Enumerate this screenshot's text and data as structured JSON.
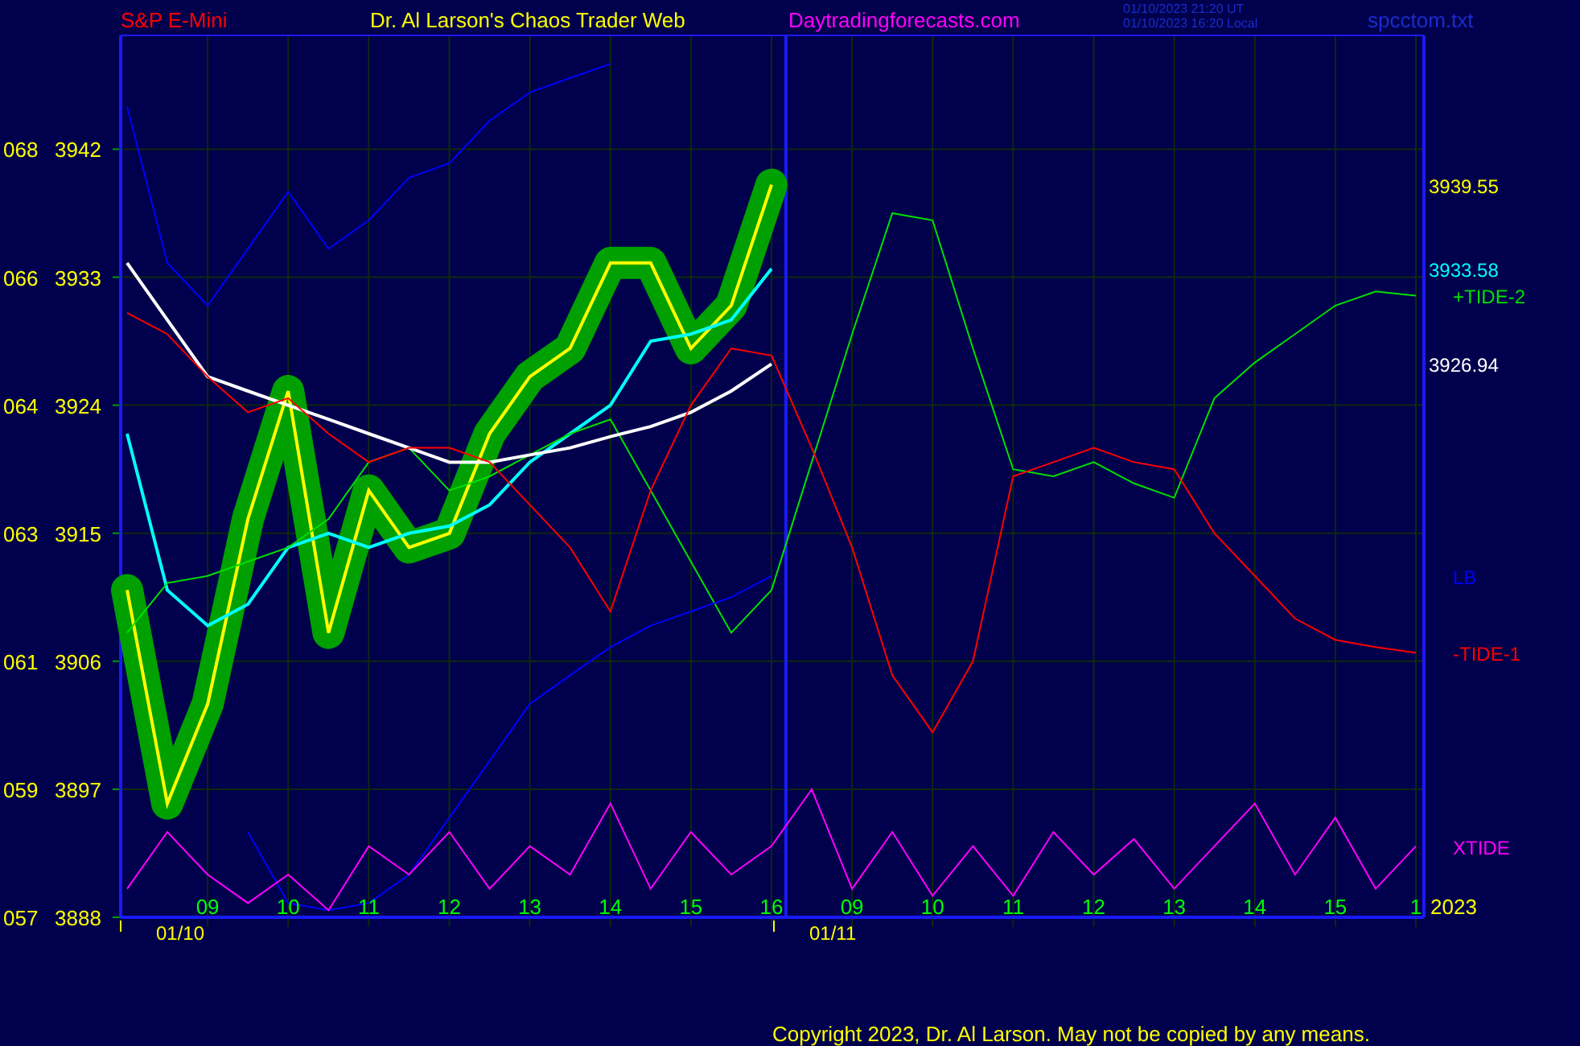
{
  "header": {
    "instrument": "S&P E-Mini",
    "title": "Dr. Al Larson's Chaos Trader Web",
    "site": "Daytradingforecasts.com",
    "timestamps": [
      "01/10/2023 21:20 UT",
      "01/10/2023 16:20 Local"
    ],
    "file": "spcctom.txt"
  },
  "chart": {
    "chart_data": {
      "type": "line",
      "categories": [
        null,
        null,
        "09",
        null,
        "10",
        null,
        "11",
        null,
        "12",
        null,
        "13",
        null,
        "14",
        null,
        "15",
        null,
        "16",
        null,
        "09",
        null,
        "10",
        null,
        "11",
        null,
        "12",
        null,
        "13",
        null,
        "14",
        null,
        "15",
        null,
        "1"
      ],
      "ylim": [
        3888,
        3950
      ],
      "yticks": [
        3942,
        3933,
        3924,
        3915,
        3906,
        3897,
        3888
      ],
      "series": [
        {
          "color": "#ffff00",
          "values": [
            3911,
            3896,
            3903,
            3916,
            3925,
            3908,
            3918,
            3914,
            3915,
            3922,
            3926,
            3928,
            3934,
            3934,
            3928,
            3931,
            3939.5,
            null,
            null,
            null,
            null,
            null,
            null,
            null,
            null,
            null,
            null,
            null,
            null,
            null,
            null,
            null,
            null
          ]
        },
        {
          "color": "#00ffff",
          "values": [
            3922,
            3911,
            3908.5,
            3910,
            3914,
            3915,
            3914,
            3915,
            3915.5,
            3917,
            3920,
            3922,
            3924,
            3928.5,
            3929,
            3930,
            3933.6,
            null,
            null,
            null,
            null,
            null,
            null,
            null,
            null,
            null,
            null,
            null,
            null,
            null,
            null,
            null,
            null
          ]
        },
        {
          "color": "#00e000",
          "values": [
            3908,
            3911.5,
            3912,
            3913,
            3914,
            3916,
            3920,
            3921,
            3918,
            3919,
            3920.5,
            3922,
            3923,
            3918,
            3913,
            3908,
            3911,
            3920,
            3929,
            3937.5,
            3937,
            3928,
            3919.5,
            3919,
            3920,
            3918.5,
            3917.5,
            3924.5,
            3927,
            3929,
            3931,
            3932,
            3931.7
          ]
        },
        {
          "color": "#ffffff",
          "values": [
            3934,
            3930,
            3926,
            3925,
            3924,
            3923,
            3922,
            3921,
            3920,
            3920,
            3920.5,
            3921,
            3921.8,
            3922.5,
            3923.5,
            3925,
            3926.9,
            null,
            null,
            null,
            null,
            null,
            null,
            null,
            null,
            null,
            null,
            null,
            null,
            null,
            null,
            null,
            null
          ]
        },
        {
          "color": "#0000ff",
          "values": [
            null,
            null,
            null,
            3894,
            3889,
            3888.5,
            3889,
            3891,
            3895,
            3899,
            3903,
            3905,
            3907,
            3908.5,
            3909.5,
            3910.5,
            3912,
            null,
            null,
            null,
            null,
            null,
            null,
            null,
            null,
            null,
            null,
            null,
            null,
            null,
            null,
            null,
            null
          ]
        },
        {
          "color": "#ff0000",
          "values": [
            3930.5,
            3929,
            3926,
            3923.5,
            3924.5,
            3922,
            3920,
            3921,
            3921,
            3920,
            3917,
            3914,
            3909.5,
            3918,
            3924,
            3928,
            3927.5,
            3921,
            3914,
            3905,
            3901,
            3906,
            3919,
            3920,
            3921,
            3920,
            3919.5,
            3915,
            3912,
            3909,
            3907.5,
            3907,
            3906.6
          ]
        },
        {
          "color": "#ff00ff",
          "values": [
            3890,
            3894,
            3891,
            3889,
            3891,
            3888.5,
            3893,
            3891,
            3894,
            3890,
            3893,
            3891,
            3896,
            3890,
            3894,
            3891,
            3893,
            3897,
            3890,
            3894,
            3889.5,
            3893,
            3889.5,
            3894,
            3891,
            3893.5,
            3890,
            3893,
            3896,
            3891,
            3895,
            3890,
            3893
          ]
        },
        {
          "color": "#0000ff",
          "values": [
            3945,
            3934,
            3931,
            3935,
            3939,
            3935,
            3937,
            3940,
            3941,
            3944,
            3946,
            3947,
            3948,
            null,
            null,
            null,
            null,
            null,
            null,
            null,
            null,
            null,
            null,
            null,
            null,
            null,
            null,
            null,
            null,
            null,
            null,
            null,
            null
          ]
        }
      ],
      "grid": true
    },
    "y_codes": [
      "068",
      "066",
      "064",
      "063",
      "061",
      "059",
      "057"
    ],
    "line_labels": [
      {
        "text": "3939.55",
        "kind": "value"
      },
      {
        "text": "3933.58",
        "kind": "value"
      },
      {
        "text": "+TIDE-2",
        "kind": "name"
      },
      {
        "text": "3926.94",
        "kind": "value"
      },
      {
        "text": "LB",
        "kind": "name"
      },
      {
        "text": "-TIDE-1",
        "kind": "name"
      },
      {
        "text": "XTIDE",
        "kind": "name"
      }
    ],
    "dates": [
      "01/10",
      "01/11"
    ],
    "year": "2023"
  },
  "footer": "Copyright 2023, Dr. Al Larson. May not be copied by any means."
}
